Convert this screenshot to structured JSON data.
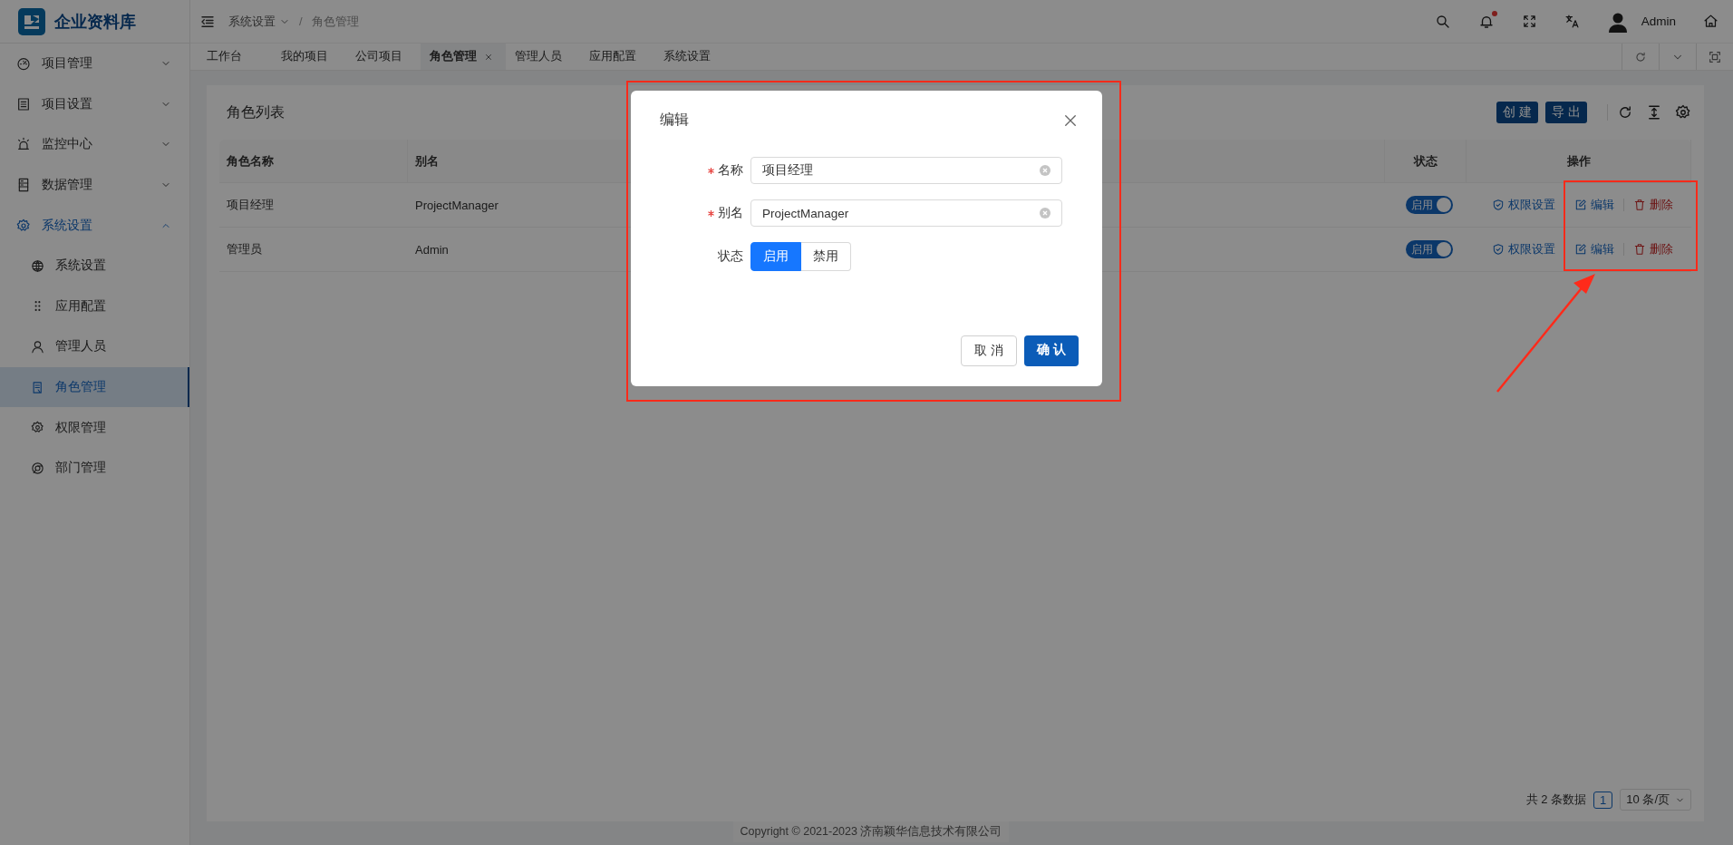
{
  "app": {
    "title": "企业资料库"
  },
  "sidebar": {
    "items": [
      {
        "label": "项目管理",
        "expanded": false,
        "selected": false
      },
      {
        "label": "项目设置",
        "expanded": false,
        "selected": false
      },
      {
        "label": "监控中心",
        "expanded": false,
        "selected": false
      },
      {
        "label": "数据管理",
        "expanded": false,
        "selected": false
      },
      {
        "label": "系统设置",
        "expanded": true,
        "selected": true,
        "children": [
          {
            "label": "系统设置",
            "selected": false
          },
          {
            "label": "应用配置",
            "selected": false
          },
          {
            "label": "管理人员",
            "selected": false
          },
          {
            "label": "角色管理",
            "selected": true
          },
          {
            "label": "权限管理",
            "selected": false
          },
          {
            "label": "部门管理",
            "selected": false
          }
        ]
      }
    ]
  },
  "header": {
    "breadcrumb": [
      "系统设置",
      "角色管理"
    ],
    "breadcrumb_separator": "/",
    "has_notification": true,
    "user": "Admin"
  },
  "tabs": [
    {
      "label": "工作台",
      "selected": false
    },
    {
      "label": "我的项目",
      "selected": false
    },
    {
      "label": "公司项目",
      "selected": false
    },
    {
      "label": "角色管理",
      "selected": true
    },
    {
      "label": "管理人员",
      "selected": false
    },
    {
      "label": "应用配置",
      "selected": false
    },
    {
      "label": "系统设置",
      "selected": false
    }
  ],
  "table": {
    "title": "角色列表",
    "buttons": [
      "创 建",
      "导 出"
    ],
    "columns": [
      "角色名称",
      "别名",
      "状态",
      "操作"
    ],
    "rows": [
      {
        "name": "项目经理",
        "alias": "ProjectManager",
        "status": {
          "label": "启用",
          "on": true
        },
        "actions": [
          {
            "kind": "permission",
            "label": "权限设置"
          },
          {
            "kind": "edit",
            "label": "编辑"
          },
          {
            "kind": "delete",
            "label": "删除"
          }
        ]
      },
      {
        "name": "管理员",
        "alias": "Admin",
        "status": {
          "label": "启用",
          "on": true
        },
        "actions": [
          {
            "kind": "permission",
            "label": "权限设置"
          },
          {
            "kind": "edit",
            "label": "编辑"
          },
          {
            "kind": "delete",
            "label": "删除"
          }
        ]
      }
    ]
  },
  "pagination": {
    "total": "共 2 条数据",
    "pages": [
      {
        "label": "1",
        "selected": true
      }
    ],
    "page_size": "10 条/页"
  },
  "footer": {
    "copyright": "Copyright © 2021-2023 济南颖华信息技术有限公司"
  },
  "dialog": {
    "title": "编辑",
    "fields": [
      {
        "label": "名称",
        "required": true,
        "value": "项目经理"
      },
      {
        "label": "别名",
        "required": true,
        "value": "ProjectManager"
      }
    ],
    "status": {
      "label": "状态",
      "options": [
        {
          "label": "启用",
          "selected": true
        },
        {
          "label": "禁用",
          "selected": false
        }
      ]
    },
    "buttons": [
      {
        "kind": "default",
        "label": "取 消"
      },
      {
        "kind": "primary",
        "label": "确 认"
      }
    ]
  }
}
